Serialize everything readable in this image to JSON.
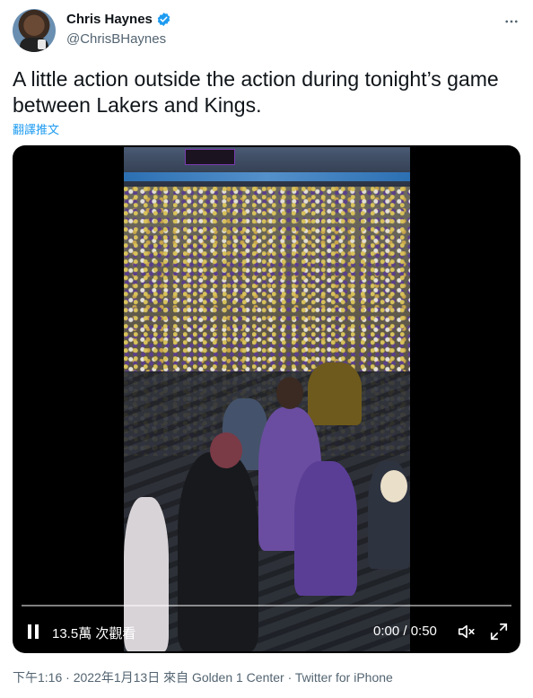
{
  "author": {
    "display_name": "Chris Haynes",
    "handle": "@ChrisBHaynes",
    "verified_icon": "verified-badge-icon"
  },
  "tweet": {
    "text": "A little action outside the action during tonight’s game between Lakers and Kings.",
    "translate_label": "翻譯推文"
  },
  "video": {
    "views_label": "13.5萬 次觀看",
    "time_label": "0:00 / 0:50",
    "progress_fraction": 0
  },
  "meta": {
    "text": "下午1:16 · 2022年1月13日 來自 Golden 1 Center · Twitter for iPhone"
  },
  "colors": {
    "accent": "#1d9bf0",
    "secondary_text": "#536471",
    "primary_text": "#0f1419"
  }
}
